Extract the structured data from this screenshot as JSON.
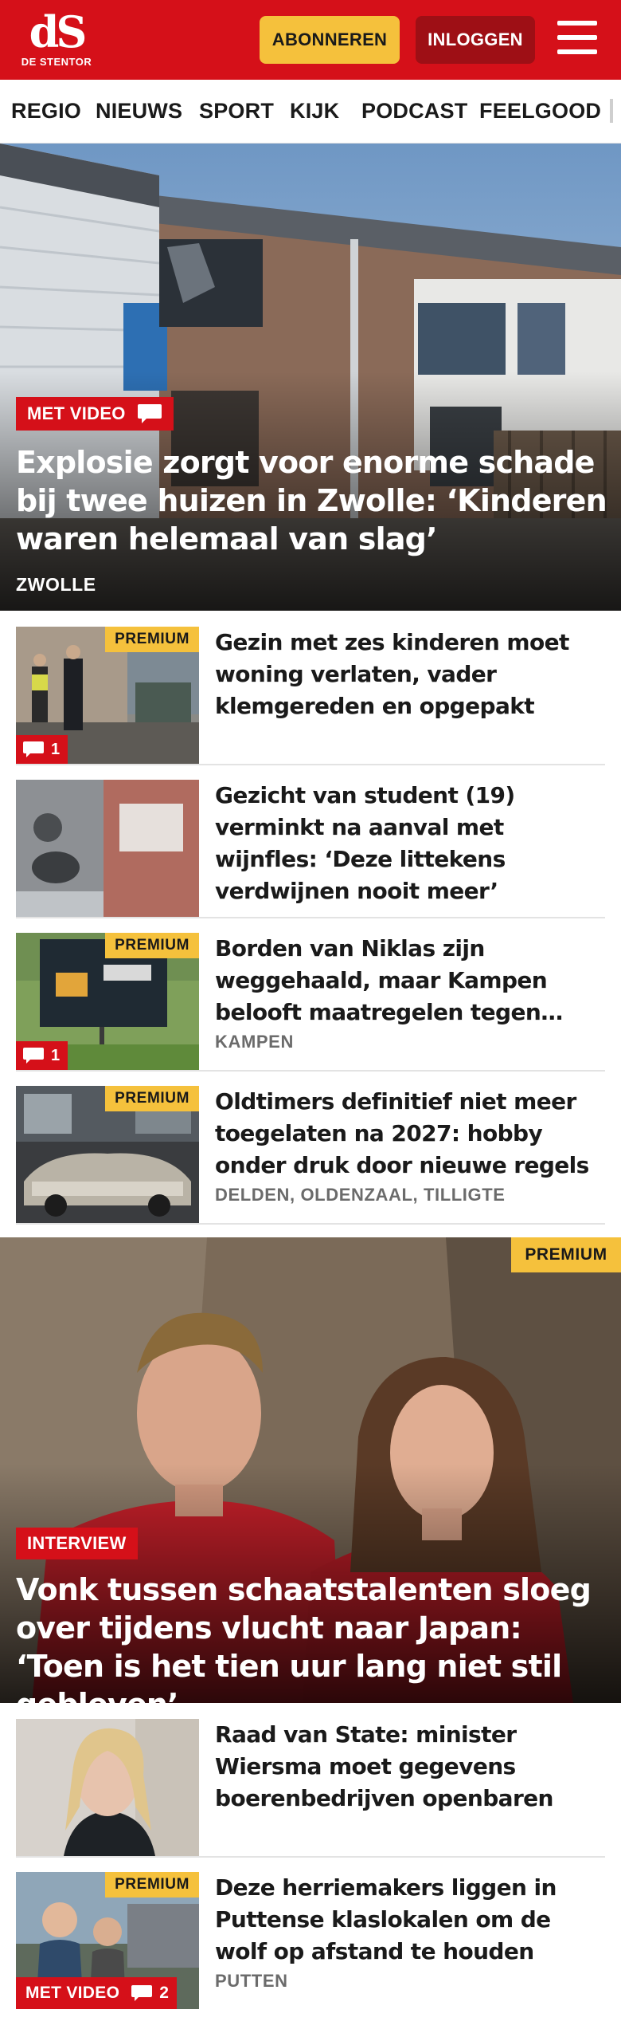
{
  "header": {
    "logo_mark": "dS",
    "logo_text": "DE STENTOR",
    "subscribe_label": "ABONNEREN",
    "login_label": "INLOGGEN",
    "brand_color": "#d51019",
    "accent_color": "#f5c13c"
  },
  "nav": {
    "items": [
      "REGIO",
      "NIEUWS",
      "SPORT",
      "KIJK",
      "PODCAST",
      "FEELGOOD"
    ]
  },
  "hero1": {
    "tag": "MET VIDEO",
    "title": "Explosie zorgt voor enorme schade bij twee huizen in Zwolle: ‘Kinderen waren helemaal van slag’",
    "place": "ZWOLLE"
  },
  "articles_top": [
    {
      "title": "Gezin met zes kinderen moet woning verlaten, vader klemgereden en opgepakt",
      "premium": "PREMIUM",
      "comments": "1"
    },
    {
      "title": "Gezicht van student (19) verminkt na aanval met wijnfles: ‘Deze littekens verdwijnen nooit meer’"
    },
    {
      "title": "Borden van Niklas zijn weggehaald, maar Kampen belooft maatregelen tegen…",
      "premium": "PREMIUM",
      "comments": "1",
      "place": "KAMPEN"
    },
    {
      "title": "Oldtimers definitief niet meer toegelaten na 2027: hobby onder druk door nieuwe regels",
      "premium": "PREMIUM",
      "place": "DELDEN, OLDENZAAL, TILLIGTE"
    }
  ],
  "hero2": {
    "premium": "PREMIUM",
    "tag": "INTERVIEW",
    "title": "Vonk tussen schaatstalenten sloeg over tijdens vlucht naar Japan: ‘Toen is het tien uur lang niet stil gebleven’"
  },
  "articles_bottom": [
    {
      "title": "Raad van State: minister Wiersma moet gegevens boerenbedrijven openbaren"
    },
    {
      "title": "Deze herriemakers liggen in Puttense klaslokalen om de wolf op afstand te houden",
      "premium": "PREMIUM",
      "video": "MET VIDEO",
      "comments": "2",
      "place": "PUTTEN"
    }
  ]
}
